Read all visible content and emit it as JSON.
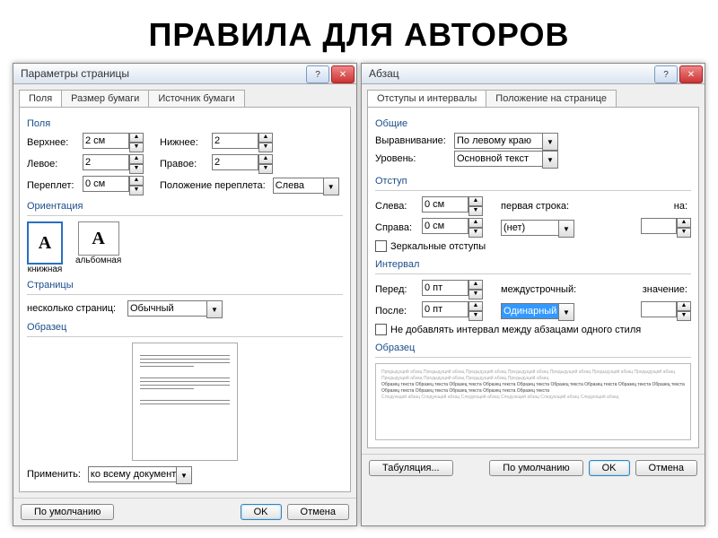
{
  "heading": "ПРАВИЛА ДЛЯ АВТОРОВ",
  "page_setup": {
    "title": "Параметры страницы",
    "tabs": [
      "Поля",
      "Размер бумаги",
      "Источник бумаги"
    ],
    "fields_group": "Поля",
    "top_label": "Верхнее:",
    "top_value": "2 см",
    "bottom_label": "Нижнее:",
    "bottom_value": "2",
    "left_label": "Левое:",
    "left_value": "2",
    "right_label": "Правое:",
    "right_value": "2",
    "gutter_label": "Переплет:",
    "gutter_value": "0 см",
    "gutter_pos_label": "Положение переплета:",
    "gutter_pos_value": "Слева",
    "orientation_group": "Ориентация",
    "portrait": "книжная",
    "landscape": "альбомная",
    "pages_group": "Страницы",
    "multi_label": "несколько страниц:",
    "multi_value": "Обычный",
    "sample_group": "Образец",
    "apply_label": "Применить:",
    "apply_value": "ко всему документу",
    "default_btn": "По умолчанию",
    "ok_btn": "OK",
    "cancel_btn": "Отмена"
  },
  "paragraph": {
    "title": "Абзац",
    "tabs": [
      "Отступы и интервалы",
      "Положение на странице"
    ],
    "general_group": "Общие",
    "align_label": "Выравнивание:",
    "align_value": "По левому краю",
    "level_label": "Уровень:",
    "level_value": "Основной текст",
    "indent_group": "Отступ",
    "ind_left_label": "Слева:",
    "ind_left_value": "0 см",
    "ind_right_label": "Справа:",
    "ind_right_value": "0 см",
    "first_line_label": "первая строка:",
    "first_line_value": "(нет)",
    "by1_label": "на:",
    "mirror_label": "Зеркальные отступы",
    "spacing_group": "Интервал",
    "before_label": "Перед:",
    "before_value": "0 пт",
    "after_label": "После:",
    "after_value": "0 пт",
    "line_label": "междустрочный:",
    "line_value": "Одинарный",
    "by2_label": "значение:",
    "no_add_label": "Не добавлять интервал между абзацами одного стиля",
    "sample_group": "Образец",
    "sample_prev": "Предыдущий абзац Предыдущий абзац Предыдущий абзац Предыдущий абзац Предыдущий абзац Предыдущий абзац Предыдущий абзац Предыдущий абзац Предыдущий абзац Предыдущий абзац Предыдущий абзац",
    "sample_mid": "Образец текста Образец текста Образец текста Образец текста Образец текста Образец текста Образец текста Образец текста Образец текста Образец текста Образец текста Образец текста Образец текста Образец текста",
    "sample_next": "Следующий абзац Следующий абзац Следующий абзац Следующий абзац Следующий абзац Следующий абзац",
    "tabs_btn": "Табуляция...",
    "default_btn": "По умолчанию",
    "ok_btn": "OK",
    "cancel_btn": "Отмена"
  }
}
